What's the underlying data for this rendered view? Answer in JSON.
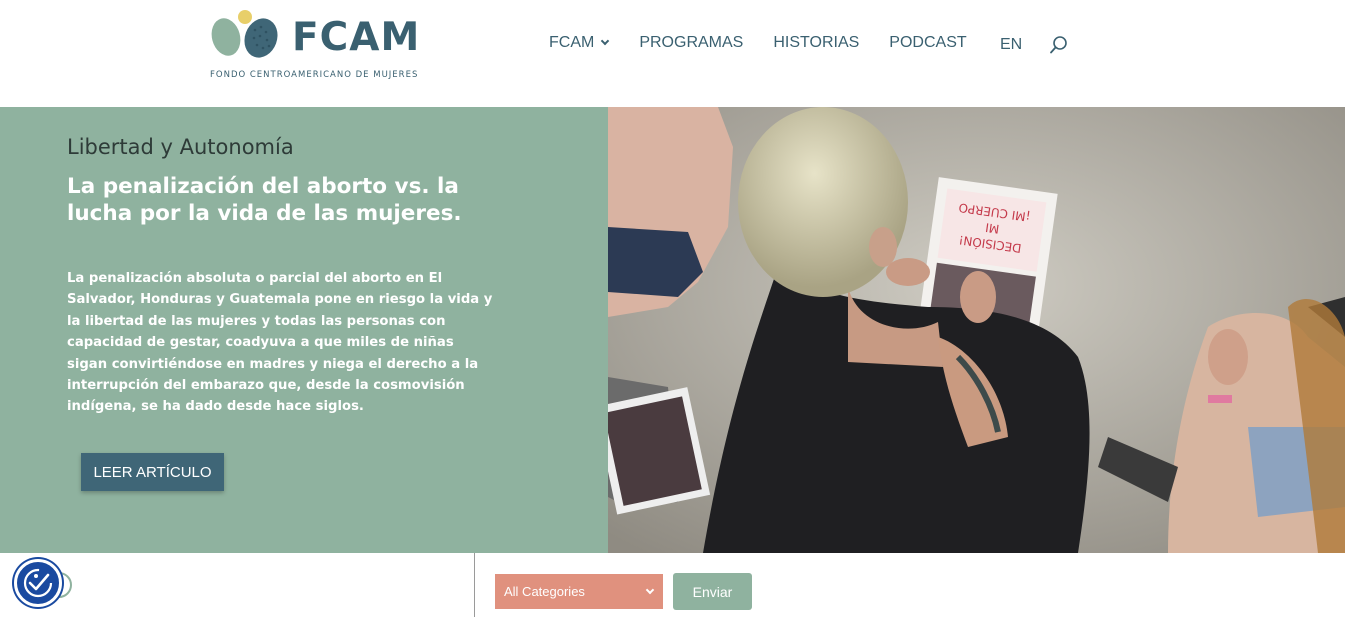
{
  "colors": {
    "brand": "#3a6070",
    "hero_bg": "#8fb29f",
    "button_dark": "#3f6677",
    "select_bg": "#e0917e",
    "accessibility": "#1a4aa0"
  },
  "header": {
    "logo_word": "FCAM",
    "logo_sub": "FONDO CENTROAMERICANO DE MUJERES",
    "nav": [
      {
        "label": "FCAM",
        "has_dropdown": true
      },
      {
        "label": "PROGRAMAS"
      },
      {
        "label": "HISTORIAS"
      },
      {
        "label": "PODCAST"
      }
    ],
    "lang": "EN",
    "search_icon": "search-icon"
  },
  "hero": {
    "category": "Libertad y Autonomía",
    "title": "La penalización del aborto vs. la lucha por la vida de las mujeres.",
    "body": "La penalización absoluta o parcial del aborto en El Salvador, Honduras y Guatemala pone en riesgo la vida y la libertad de las mujeres y todas las personas con capacidad de gestar, coadyuva a que miles de niñas sigan convirtiéndose en madres y niega el derecho a la interrupción del embarazo que, desde la cosmovisión indígena, se ha dado desde hace siglos.",
    "button": "LEER ARTÍCULO",
    "photo_sign": [
      "¡MI CUERPO",
      "MI",
      "DECISIÓN!"
    ]
  },
  "filter": {
    "select_value": "All Categories",
    "submit": "Enviar"
  },
  "accessibility": {
    "icon": "accessibility-icon"
  }
}
